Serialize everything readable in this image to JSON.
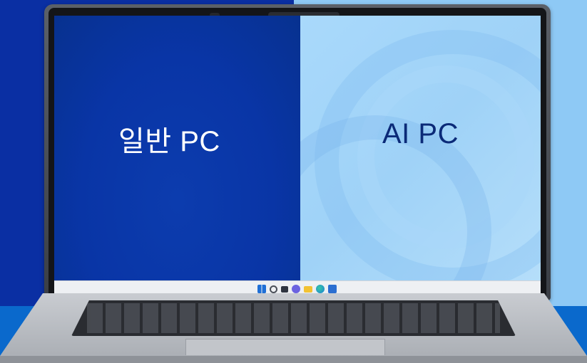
{
  "labels": {
    "normal_pc": "일반 PC",
    "ai_pc": "AI PC"
  },
  "colors": {
    "left_background": "#0a2fa3",
    "right_background": "#8ec9f5",
    "floor": "#0a69cc",
    "normal_pc_text": "#ffffff",
    "ai_pc_text": "#0b2a78"
  },
  "taskbar": {
    "icons": [
      "windows-start-icon",
      "search-icon",
      "task-view-icon",
      "chat-icon",
      "file-explorer-icon",
      "edge-browser-icon",
      "store-icon"
    ]
  }
}
